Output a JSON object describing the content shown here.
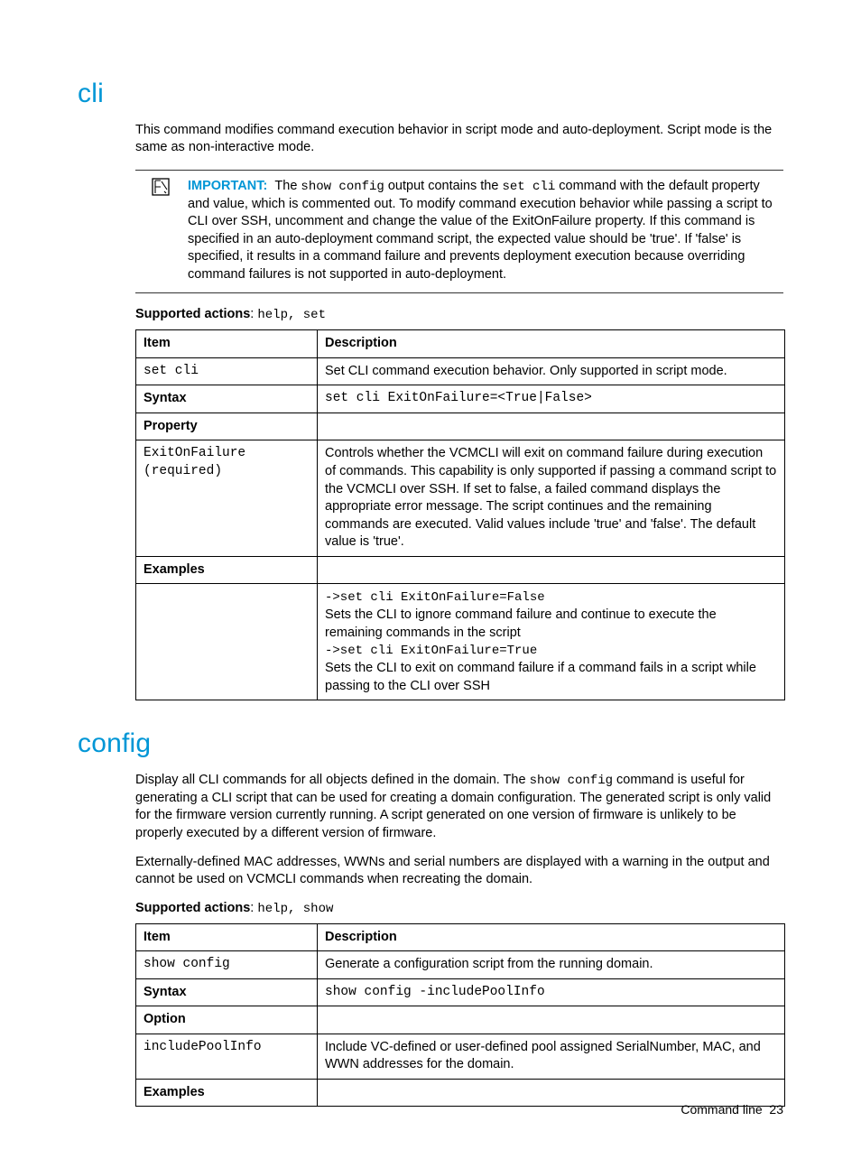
{
  "cli": {
    "heading": "cli",
    "intro": "This command modifies command execution behavior in script mode and auto-deployment. Script mode is the same as non-interactive mode.",
    "important_label": "IMPORTANT:",
    "important_pre": "The ",
    "important_code1": "show config",
    "important_mid1": " output contains the ",
    "important_code2": "set cli",
    "important_tail": " command with the default property and value, which is commented out. To modify command execution behavior while passing a script to CLI over SSH, uncomment and change the value of the ExitOnFailure property. If this command is specified in an auto-deployment command script, the expected value should be 'true'. If 'false' is specified, it results in a command failure and prevents deployment execution because overriding command failures is not supported in auto-deployment.",
    "supported_label": "Supported actions",
    "supported_values": "help, set",
    "table": {
      "h1": "Item",
      "h2": "Description",
      "r1c1": "set cli",
      "r1c2": "Set CLI command execution behavior. Only supported in script mode.",
      "r2c1": "Syntax",
      "r2c2": "set cli ExitOnFailure=<True|False>",
      "r3c1": "Property",
      "r4c1": "ExitOnFailure (required)",
      "r4c2": "Controls whether the VCMCLI will exit on command failure during execution of commands. This capability is only supported if passing a command script to the VCMCLI over SSH. If set to false, a failed command displays the appropriate error message. The script continues and the remaining commands are executed. Valid values include 'true' and 'false'. The default value is 'true'.",
      "r5c1": "Examples",
      "ex1_cmd": "->set cli ExitOnFailure=False",
      "ex1_txt": "Sets the CLI to ignore command failure and continue to execute the remaining commands in the script",
      "ex2_cmd": "->set cli ExitOnFailure=True",
      "ex2_txt": "Sets the CLI to exit on command failure if a command fails in a script while passing to the CLI over SSH"
    }
  },
  "config": {
    "heading": "config",
    "p1_pre": "Display all CLI commands for all objects defined in the domain. The ",
    "p1_code": "show config",
    "p1_tail": " command is useful for generating a CLI script that can be used for creating a domain configuration. The generated script is only valid for the firmware version currently running. A script generated on one version of firmware is unlikely to be properly executed by a different version of firmware.",
    "p2": "Externally-defined MAC addresses, WWNs and serial numbers are displayed with a warning in the output and cannot be used on VCMCLI commands when recreating the domain.",
    "supported_label": "Supported actions",
    "supported_values": "help, show",
    "table": {
      "h1": "Item",
      "h2": "Description",
      "r1c1": "show config",
      "r1c2": "Generate a configuration script from the running domain.",
      "r2c1": "Syntax",
      "r2c2": "show config -includePoolInfo",
      "r3c1": "Option",
      "r4c1": "includePoolInfo",
      "r4c2": "Include VC-defined or user-defined pool assigned SerialNumber, MAC, and WWN addresses for the domain.",
      "r5c1": "Examples"
    }
  },
  "footer": {
    "text": "Command line",
    "page": "23"
  }
}
